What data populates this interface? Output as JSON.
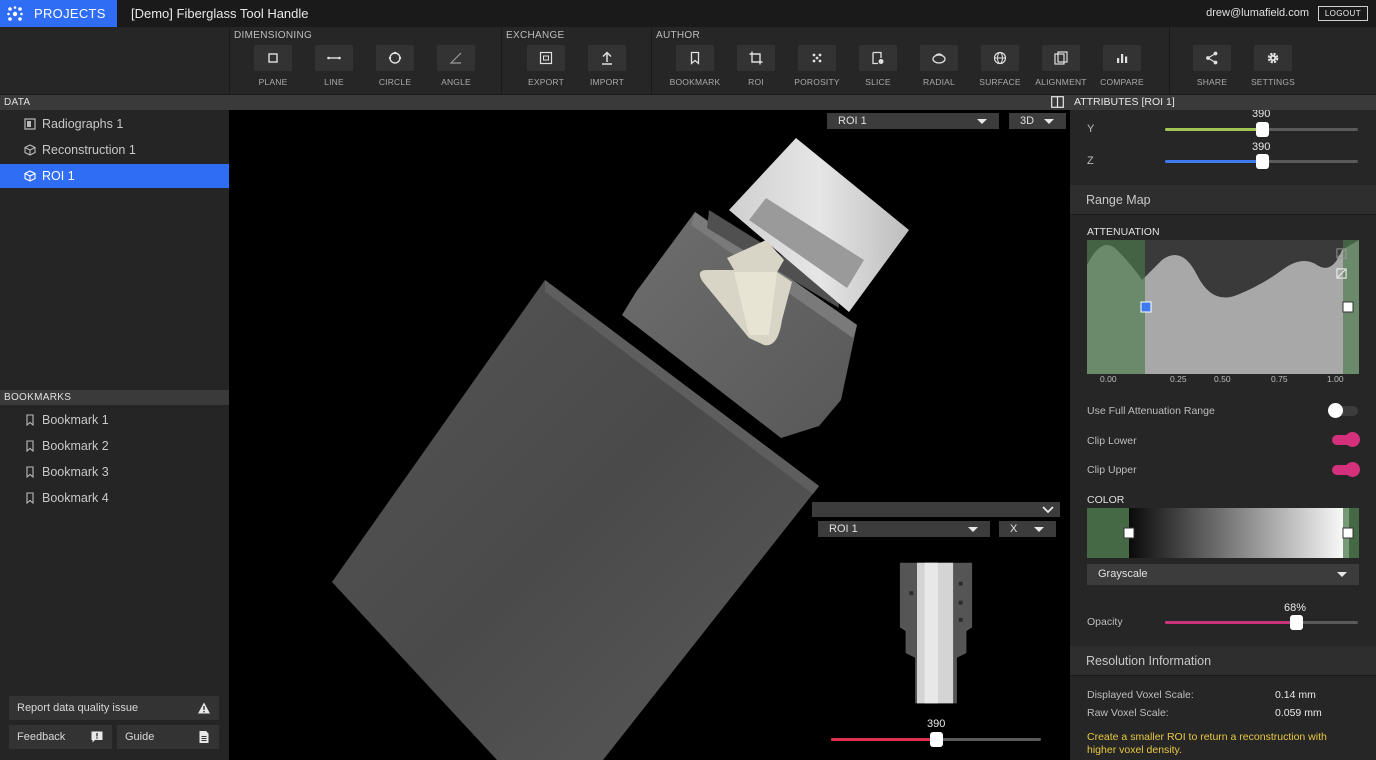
{
  "topbar": {
    "projects_label": "PROJECTS",
    "title": "[Demo] Fiberglass Tool Handle",
    "user_email": "drew@lumafield.com",
    "logout_label": "LOGOUT"
  },
  "toolbar": {
    "groups": [
      {
        "label": "DIMENSIONING",
        "tools": [
          {
            "label": "PLANE",
            "icon": "plane-icon"
          },
          {
            "label": "LINE",
            "icon": "line-icon"
          },
          {
            "label": "CIRCLE",
            "icon": "circle-icon"
          },
          {
            "label": "ANGLE",
            "icon": "angle-icon"
          }
        ]
      },
      {
        "label": "EXCHANGE",
        "tools": [
          {
            "label": "EXPORT",
            "icon": "export-icon"
          },
          {
            "label": "IMPORT",
            "icon": "import-icon"
          }
        ]
      },
      {
        "label": "AUTHOR",
        "tools": [
          {
            "label": "BOOKMARK",
            "icon": "bookmark-icon"
          },
          {
            "label": "ROI",
            "icon": "crop-icon"
          },
          {
            "label": "POROSITY",
            "icon": "porosity-icon"
          },
          {
            "label": "SLICE",
            "icon": "slice-icon"
          },
          {
            "label": "RADIAL",
            "icon": "radial-icon"
          },
          {
            "label": "SURFACE",
            "icon": "surface-icon"
          },
          {
            "label": "ALIGNMENT",
            "icon": "alignment-icon"
          },
          {
            "label": "COMPARE",
            "icon": "compare-icon"
          }
        ]
      },
      {
        "label": "",
        "tools": [
          {
            "label": "SHARE",
            "icon": "share-icon"
          },
          {
            "label": "SETTINGS",
            "icon": "gear-icon"
          }
        ]
      }
    ]
  },
  "sidebar": {
    "data_header": "DATA",
    "data_items": [
      {
        "label": "Radiographs 1",
        "icon": "radiograph-icon",
        "active": false
      },
      {
        "label": "Reconstruction 1",
        "icon": "cube-icon",
        "active": false
      },
      {
        "label": "ROI 1",
        "icon": "cube-icon",
        "active": true
      }
    ],
    "bookmarks_header": "BOOKMARKS",
    "bookmarks": [
      "Bookmark 1",
      "Bookmark 2",
      "Bookmark 3",
      "Bookmark 4"
    ],
    "report_label": "Report data quality issue",
    "feedback_label": "Feedback",
    "guide_label": "Guide"
  },
  "viewer": {
    "main_roi_select": "ROI 1",
    "main_view_select": "3D",
    "inset_roi_select": "ROI 1",
    "inset_axis_select": "X",
    "inset_slider_value": "390",
    "inset_slider_fraction": 0.5
  },
  "attributes": {
    "header": "ATTRIBUTES [ROI 1]",
    "y_label": "Y",
    "y_value": "390",
    "y_fraction": 0.5,
    "z_label": "Z",
    "z_value": "390",
    "z_fraction": 0.5,
    "range_map_header": "Range Map",
    "attenuation_label": "ATTENUATION",
    "attenuation_ticks": [
      "0.00",
      "0.25",
      "0.50",
      "0.75",
      "1.00"
    ],
    "use_full_range_label": "Use Full Attenuation Range",
    "use_full_range_on": false,
    "clip_lower_label": "Clip Lower",
    "clip_lower_on": true,
    "clip_upper_label": "Clip Upper",
    "clip_upper_on": true,
    "color_label": "COLOR",
    "colormap_select": "Grayscale",
    "opacity_label": "Opacity",
    "opacity_value": "68%",
    "opacity_fraction": 0.68,
    "resolution_header": "Resolution Information",
    "displayed_voxel_label": "Displayed Voxel Scale:",
    "displayed_voxel_value": "0.14 mm",
    "raw_voxel_label": "Raw Voxel Scale:",
    "raw_voxel_value": "0.059 mm",
    "hint": "Create a smaller ROI to return a reconstruction with higher voxel density."
  },
  "colors": {
    "accent_blue": "#2f6df5",
    "y_slider": "#a4c454",
    "z_slider": "#3d7af0",
    "opacity_slider": "#c8337a",
    "toggle_on": "#d4307c",
    "inset_slider": "#e0304a",
    "hint_text": "#e8c842"
  }
}
